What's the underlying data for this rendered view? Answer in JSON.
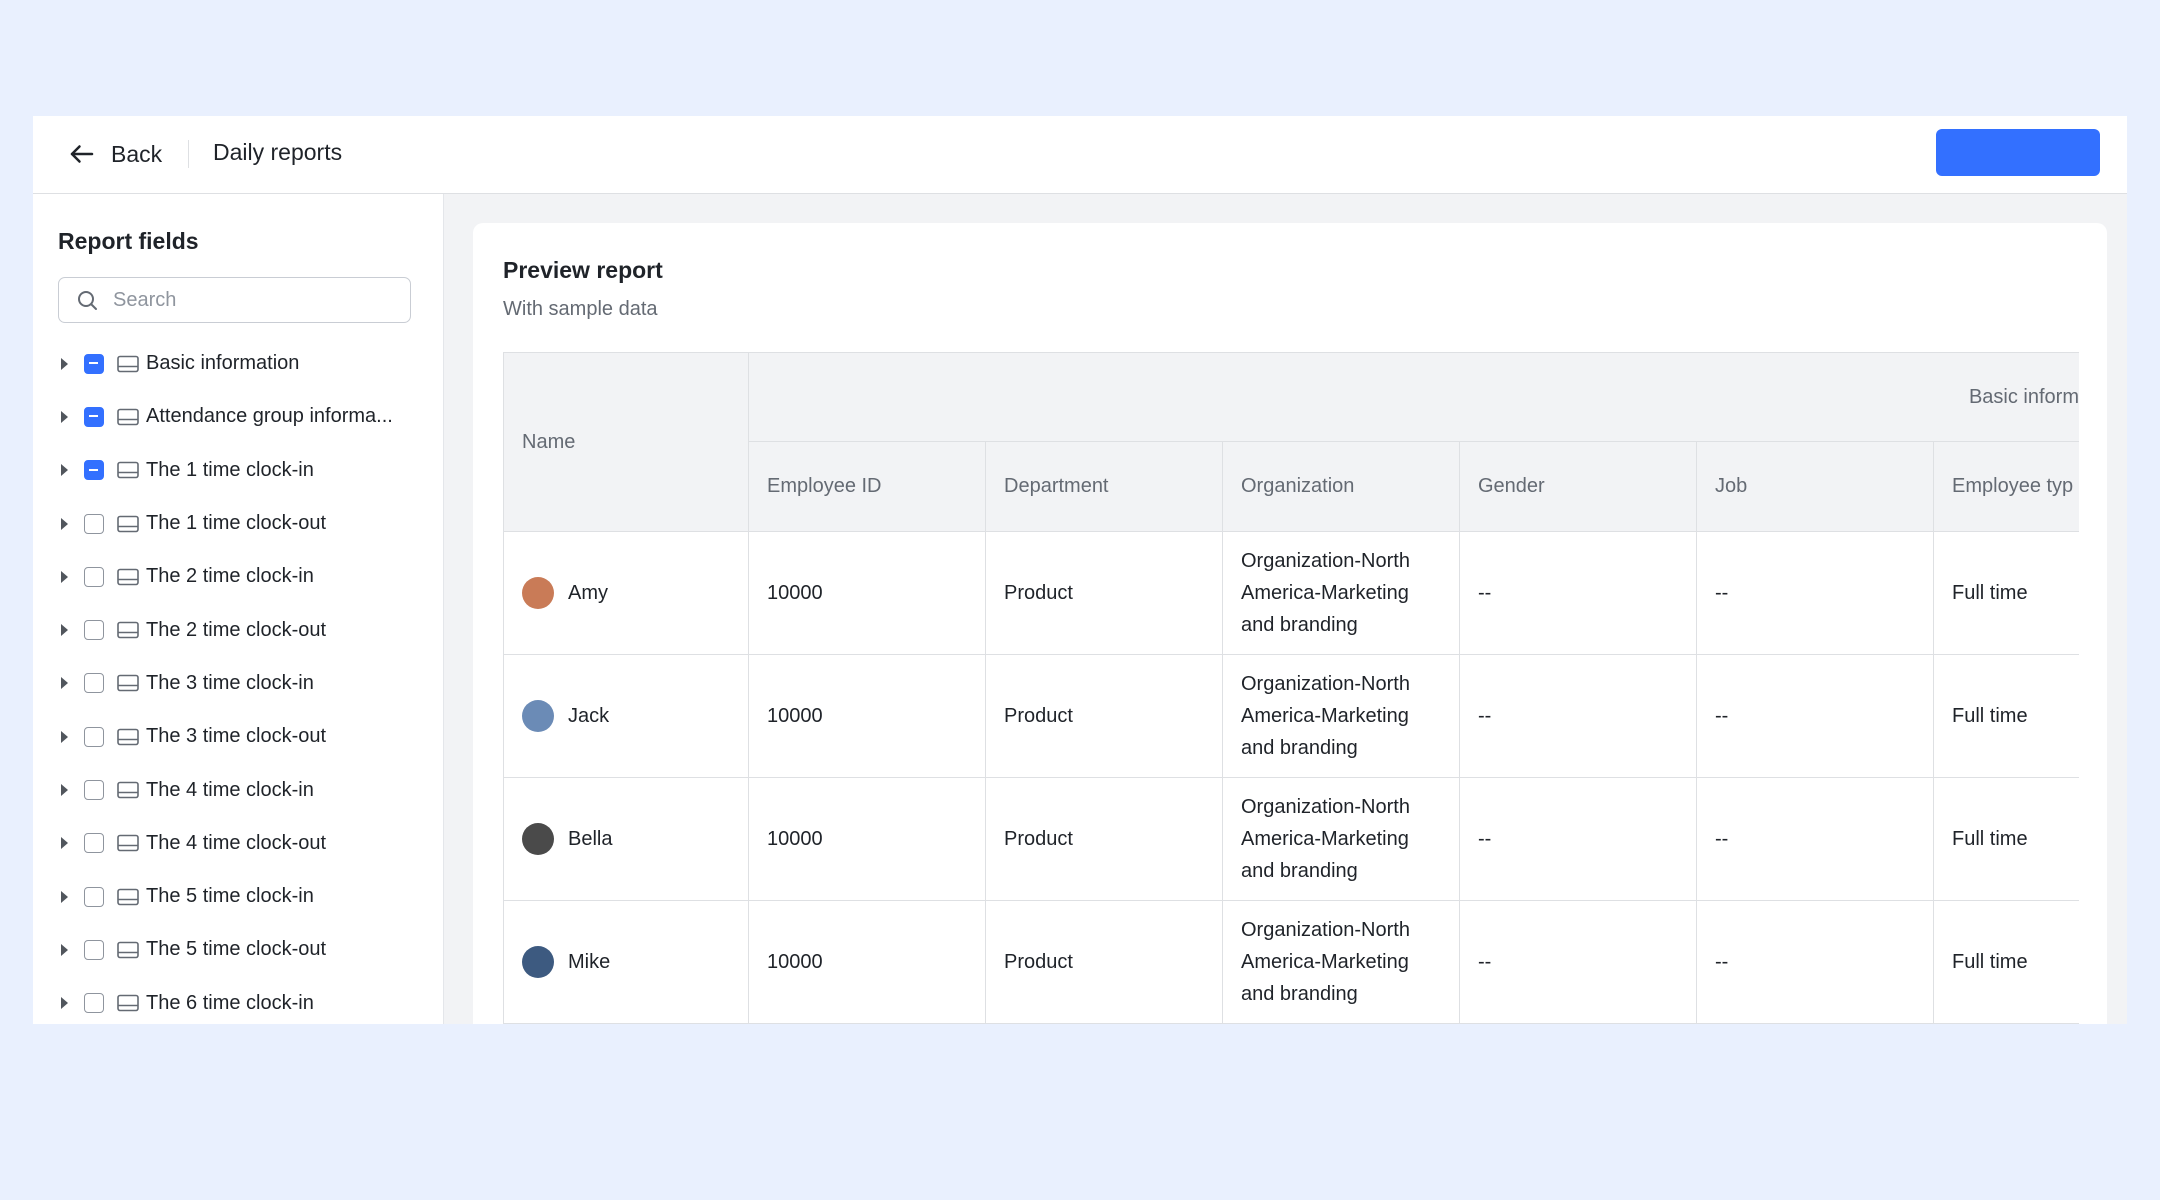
{
  "header": {
    "back_label": "Back",
    "title": "Daily reports",
    "primary_button_label": "",
    "accent_color": "#3370ff"
  },
  "sidebar": {
    "title": "Report fields",
    "search_placeholder": "Search",
    "items": [
      {
        "label": "Basic information",
        "check": "partial"
      },
      {
        "label": "Attendance group informa...",
        "check": "partial"
      },
      {
        "label": "The 1 time clock-in",
        "check": "partial"
      },
      {
        "label": "The 1 time clock-out",
        "check": "unchecked"
      },
      {
        "label": "The 2 time clock-in",
        "check": "unchecked"
      },
      {
        "label": "The 2 time clock-out",
        "check": "unchecked"
      },
      {
        "label": "The 3 time clock-in",
        "check": "unchecked"
      },
      {
        "label": "The 3 time clock-out",
        "check": "unchecked"
      },
      {
        "label": "The 4 time clock-in",
        "check": "unchecked"
      },
      {
        "label": "The 4 time clock-out",
        "check": "unchecked"
      },
      {
        "label": "The 5 time clock-in",
        "check": "unchecked"
      },
      {
        "label": "The 5 time clock-out",
        "check": "unchecked"
      },
      {
        "label": "The 6 time clock-in",
        "check": "unchecked"
      }
    ]
  },
  "preview": {
    "title": "Preview report",
    "subtitle": "With sample data",
    "group_header": "Basic inform",
    "columns": {
      "name": "Name",
      "employee_id": "Employee ID",
      "department": "Department",
      "organization": "Organization",
      "gender": "Gender",
      "job": "Job",
      "employee_type": "Employee typ"
    },
    "rows": [
      {
        "name": "Amy",
        "employee_id": "10000",
        "department": "Product",
        "organization": [
          "Organization-North",
          "America-Marketing",
          "and branding"
        ],
        "gender": "--",
        "job": "--",
        "employee_type": "Full time"
      },
      {
        "name": "Jack",
        "employee_id": "10000",
        "department": "Product",
        "organization": [
          "Organization-North",
          "America-Marketing",
          "and branding"
        ],
        "gender": "--",
        "job": "--",
        "employee_type": "Full time"
      },
      {
        "name": "Bella",
        "employee_id": "10000",
        "department": "Product",
        "organization": [
          "Organization-North",
          "America-Marketing",
          "and branding"
        ],
        "gender": "--",
        "job": "--",
        "employee_type": "Full time"
      },
      {
        "name": "Mike",
        "employee_id": "10000",
        "department": "Product",
        "organization": [
          "Organization-North",
          "America-Marketing",
          "and branding"
        ],
        "gender": "--",
        "job": "--",
        "employee_type": "Full time"
      }
    ]
  }
}
